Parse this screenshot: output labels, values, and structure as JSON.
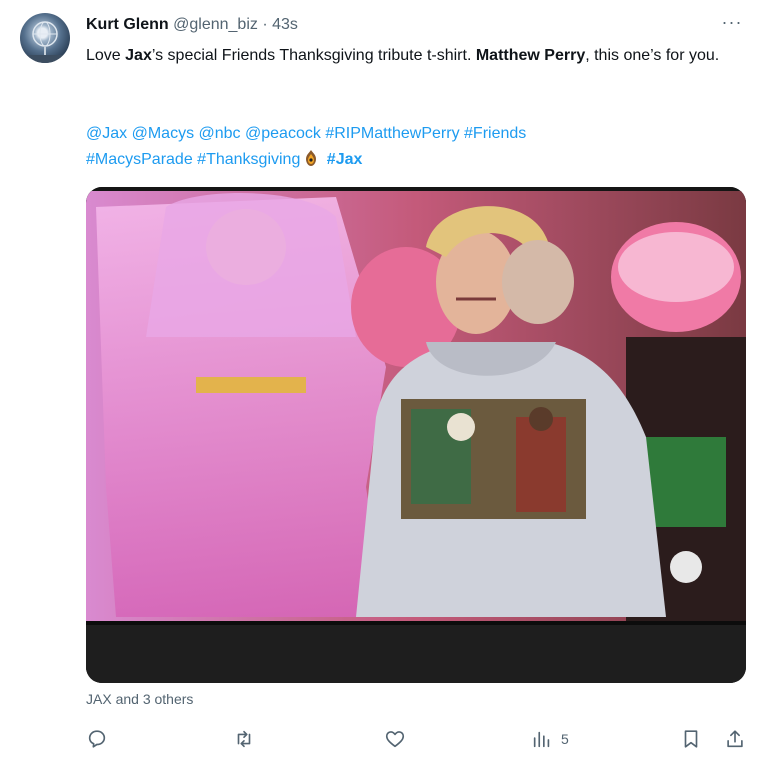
{
  "tweet": {
    "author_name": "Kurt Glenn",
    "author_handle": "@glenn_biz",
    "separator": "·",
    "time": "43s",
    "more_label": "···",
    "text": {
      "part1": "Love ",
      "bold1": "Jax",
      "part2": "’s special Friends Thanksgiving tribute t-shirt. ",
      "bold2": "Matthew Perry",
      "part3": ", this one’s for you."
    },
    "tags_line1": [
      "@Jax",
      "@Macys",
      "@nbc",
      "@peacock",
      "#RIPMatthewPerry",
      "#Friends"
    ],
    "tags_line2": [
      "#MacysParade",
      "#Thanksgiving"
    ],
    "tag_final": "#Jax",
    "liked_by": "JAX and 3 others",
    "actions": {
      "reply_icon": "reply-icon",
      "retweet_icon": "retweet-icon",
      "like_icon": "heart-icon",
      "views_icon": "views-icon",
      "views_count": "5",
      "bookmark_icon": "bookmark-icon",
      "share_icon": "share-icon"
    },
    "colors": {
      "link": "#1d9bf0",
      "muted": "#536471",
      "text": "#0f1419"
    }
  }
}
